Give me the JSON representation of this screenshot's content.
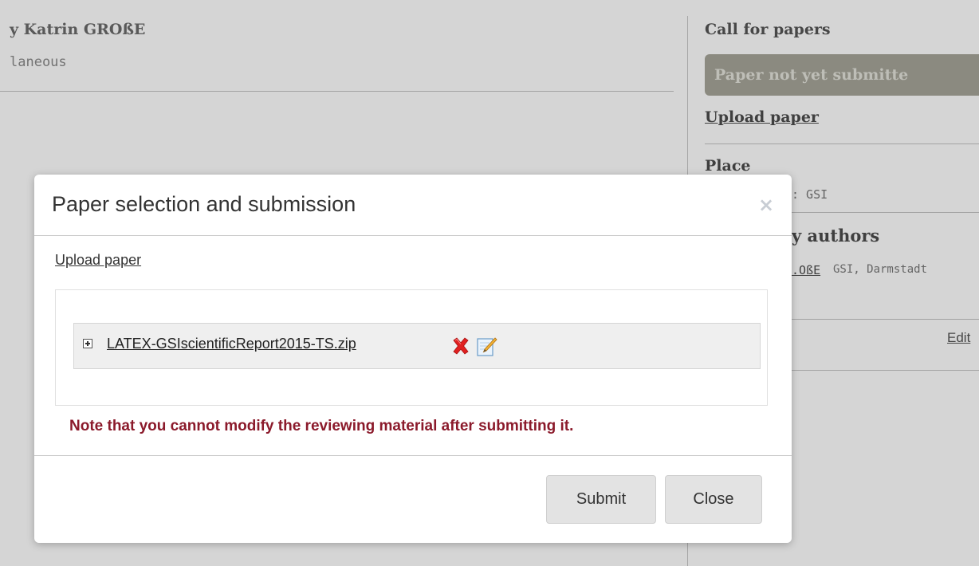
{
  "background": {
    "author_line": "y Katrin GROßE",
    "track": "laneous",
    "call_for_papers": {
      "title": "Call for papers",
      "status": "Paper not yet submitte",
      "upload_link": "Upload paper"
    },
    "place": {
      "title": "Place",
      "value": ": GSI"
    },
    "authors": {
      "title": "y authors",
      "name": ".OßE",
      "affiliation": "GSI, Darmstadt"
    },
    "edit_link": "Edit"
  },
  "modal": {
    "title": "Paper selection and submission",
    "close_symbol": "×",
    "upload_link": "Upload paper",
    "file": {
      "name": "LATEX-GSIscientificReport2015-TS.zip"
    },
    "note": "Note that you cannot modify the reviewing material after submitting it.",
    "buttons": {
      "submit": "Submit",
      "close": "Close"
    }
  },
  "colors": {
    "note": "#8b1a2b",
    "status_badge": "#a7a69a",
    "delete_icon": "#e02020"
  },
  "icons": [
    "expand-plus-icon",
    "delete-cross-icon",
    "edit-pencil-icon",
    "close-icon"
  ]
}
